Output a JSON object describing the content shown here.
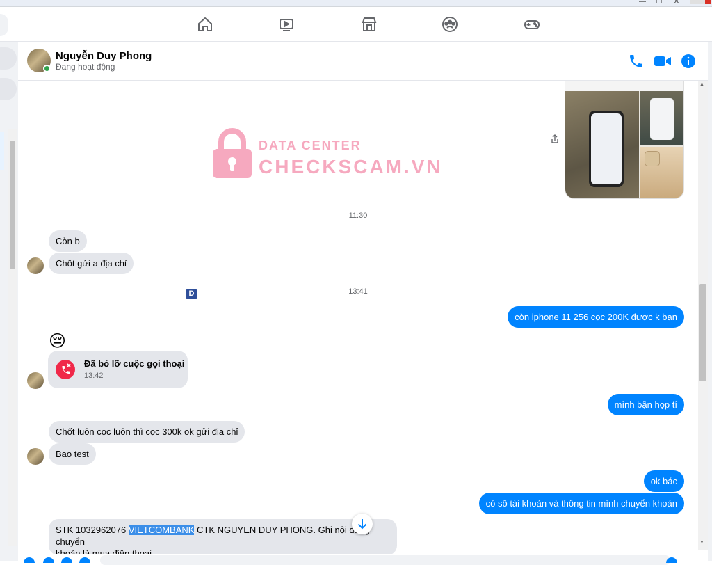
{
  "window": {
    "minimize": "—",
    "maximize": "☐",
    "close": "✕"
  },
  "nav": {
    "icons": [
      "home-icon",
      "watch-icon",
      "marketplace-icon",
      "groups-icon",
      "gaming-icon"
    ],
    "accent": "#0084ff"
  },
  "header": {
    "name": "Nguyễn Duy Phong",
    "status": "Đang hoạt động",
    "actions": [
      "phone-icon",
      "video-icon",
      "info-icon"
    ]
  },
  "watermark": {
    "line1": "DATA CENTER",
    "line2": "CHECKSCAM.VN"
  },
  "messages": {
    "ts1": "11:30",
    "m1": "Còn b",
    "m2": "Chốt gửi a địa chỉ",
    "ts2": "13:41",
    "badge": "D",
    "m3": "còn iphone 11 256 cọc 200K được k bạn",
    "emoji": "😔",
    "call_title": "Đã bỏ lỡ cuộc gọi thoại",
    "call_time": "13:42",
    "m4": "mình bận họp tí",
    "m5": "Chốt luôn cọc luôn thì cọc 300k ok gửi địa chỉ",
    "m6": "Bao test",
    "m7": "ok bác",
    "m8": "có số tài khoản và thông tin mình chuyển khoản",
    "m9_a": "STK 1032962076 ",
    "m9_hl": "VIETCOMBANK",
    "m9_b": " CTK NGUYEN DUY PHONG. Ghi nội dung chuyển",
    "m9_c": "khoản là mua điện thoại."
  },
  "colors": {
    "outgoing": "#0084ff",
    "incoming": "#e4e6eb",
    "missed_call": "#f02849",
    "watermark": "#f6a9bf"
  }
}
